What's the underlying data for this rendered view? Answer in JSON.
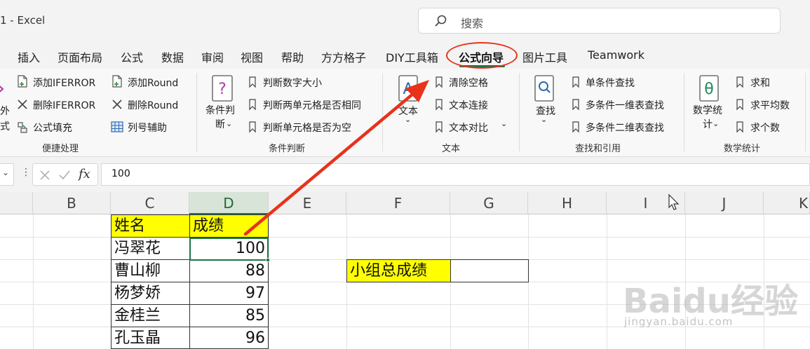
{
  "window": {
    "title": "1 - Excel",
    "search_placeholder": "搜索"
  },
  "tabs": [
    "插入",
    "页面布局",
    "公式",
    "数据",
    "审阅",
    "视图",
    "帮助",
    "方方格子",
    "DIY工具箱",
    "公式向导",
    "图片工具",
    "Teamwork"
  ],
  "active_tab": "公式向导",
  "ribbon": {
    "groups": {
      "convenience": {
        "label": "便捷处理",
        "partial_button": "外\n式",
        "items": [
          "添加IFERROR",
          "删除IFERROR",
          "公式填充",
          "添加Round",
          "删除Round",
          "列号辅助"
        ]
      },
      "condition": {
        "label": "条件判断",
        "big_button": "条件判\n断",
        "items": [
          "判断数字大小",
          "判断两单元格是否相同",
          "判断单元格是否为空"
        ]
      },
      "text": {
        "label": "文本",
        "big_button": "文本",
        "items": [
          "清除空格",
          "文本连接",
          "文本对比"
        ]
      },
      "lookup": {
        "label": "查找和引用",
        "big_button": "查找",
        "items": [
          "单条件查找",
          "多条件一维表查找",
          "多条件二维表查找"
        ]
      },
      "math": {
        "label": "数学统计",
        "big_button": "数学统\n计",
        "items": [
          "求和",
          "求平均数",
          "求个数"
        ]
      }
    }
  },
  "formula_bar": {
    "fx": "fx",
    "value": "100"
  },
  "columns": [
    "B",
    "C",
    "D",
    "E",
    "F",
    "G",
    "H",
    "I",
    "J",
    "K"
  ],
  "selected_column": "D",
  "table": {
    "header": [
      "姓名",
      "成绩"
    ],
    "rows": [
      [
        "冯翠花",
        "100"
      ],
      [
        "曹山柳",
        "88"
      ],
      [
        "杨梦娇",
        "97"
      ],
      [
        "金桂兰",
        "85"
      ],
      [
        "孔玉晶",
        "96"
      ]
    ]
  },
  "summary_label": "小组总成绩",
  "watermark": {
    "main": "Baidu经验",
    "sub": "jingyan.baidu.com"
  },
  "colors": {
    "excel_green": "#217346",
    "annotation_red": "#e8321b",
    "highlight_yellow": "#ffff00"
  }
}
